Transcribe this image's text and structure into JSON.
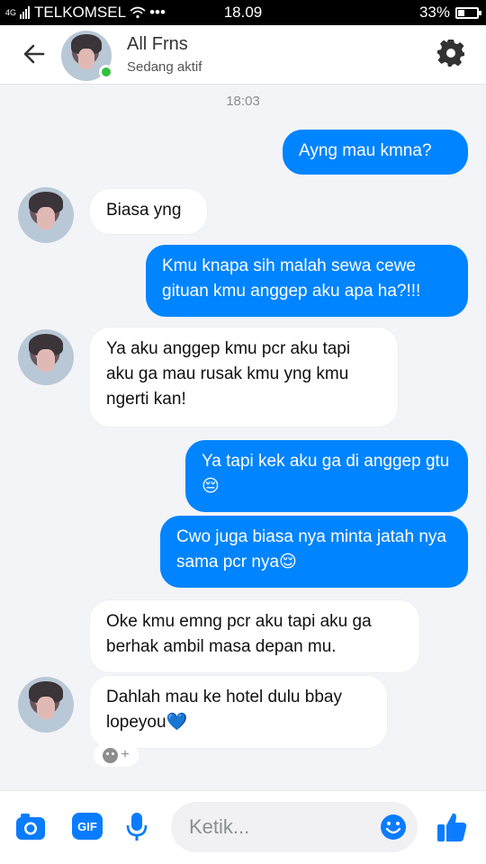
{
  "status_bar": {
    "network": "4G",
    "carrier": "TELKOMSEL",
    "dots": "•••",
    "time": "18.09",
    "battery": "33%"
  },
  "header": {
    "contact_name": "All Frns",
    "status": "Sedang aktif"
  },
  "chat": {
    "timestamp": "18:03",
    "messages": [
      {
        "side": "out",
        "text": "Ayng mau kmna?"
      },
      {
        "side": "in",
        "text": "Biasa yng"
      },
      {
        "side": "out",
        "text": "Kmu knapa sih malah sewa cewe gituan kmu anggep aku apa ha?!!!"
      },
      {
        "side": "in",
        "text": "Ya aku anggep kmu pcr aku tapi aku ga mau rusak kmu yng kmu ngerti kan!"
      },
      {
        "side": "out",
        "text": "Ya tapi kek aku ga di anggep gtu😔"
      },
      {
        "side": "out",
        "text": "Cwo juga biasa nya minta jatah nya sama pcr nya😌"
      },
      {
        "side": "in",
        "text": "Oke kmu emng pcr aku tapi aku ga berhak ambil masa depan mu."
      },
      {
        "side": "in",
        "text": "Dahlah mau ke hotel dulu bbay lopeyou💙"
      }
    ],
    "reaction_plus": "+"
  },
  "composer": {
    "placeholder": "Ketik...",
    "gif_label": "GIF"
  },
  "colors": {
    "accent": "#0084ff",
    "online": "#30c13f"
  }
}
